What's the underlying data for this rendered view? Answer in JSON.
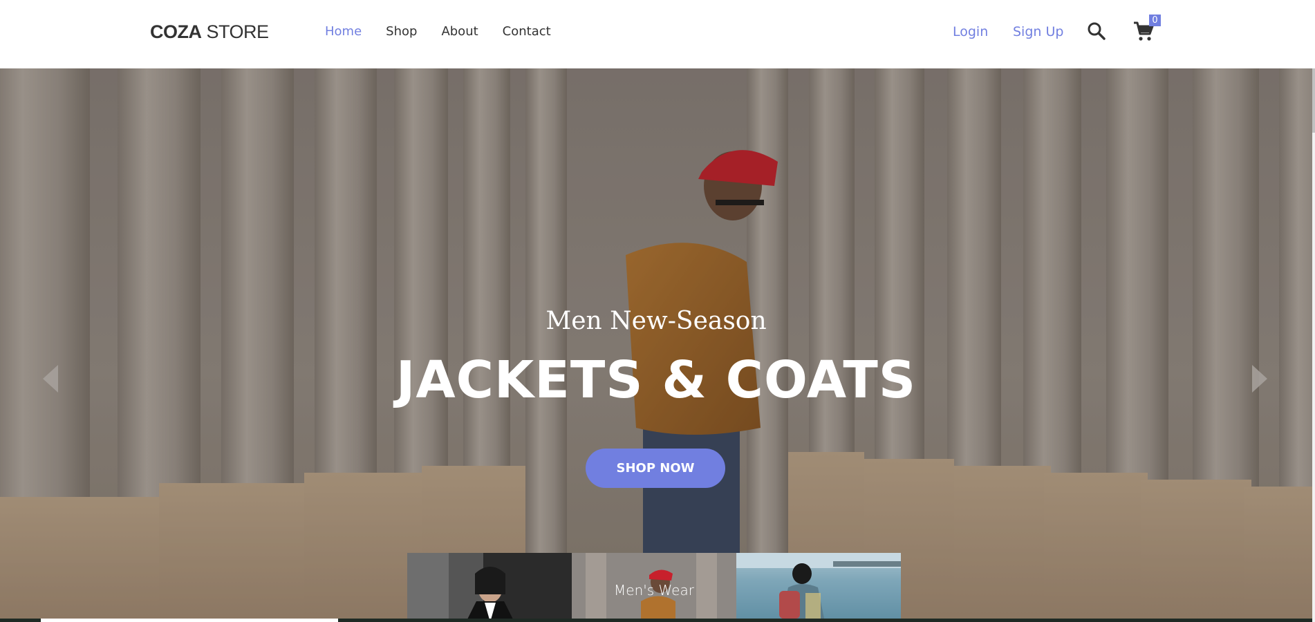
{
  "header": {
    "logo": {
      "bold": "COZA",
      "light": "STORE"
    },
    "nav": [
      {
        "label": "Home",
        "active": true
      },
      {
        "label": "Shop",
        "active": false
      },
      {
        "label": "About",
        "active": false
      },
      {
        "label": "Contact",
        "active": false
      }
    ],
    "login_label": "Login",
    "signup_label": "Sign Up",
    "search_icon": "search-icon",
    "cart_icon": "cart-icon",
    "cart_count": "0"
  },
  "hero": {
    "subtitle": "Men New-Season",
    "title": "JACKETS & COATS",
    "button_label": "SHOP NOW",
    "prev_icon": "chevron-left-icon",
    "next_icon": "chevron-right-icon"
  },
  "thumbnails": [
    {
      "label": ""
    },
    {
      "label": "Men's Wear"
    },
    {
      "label": ""
    }
  ],
  "colors": {
    "accent": "#717fe0",
    "text": "#333333",
    "badge": "#717fe0"
  }
}
